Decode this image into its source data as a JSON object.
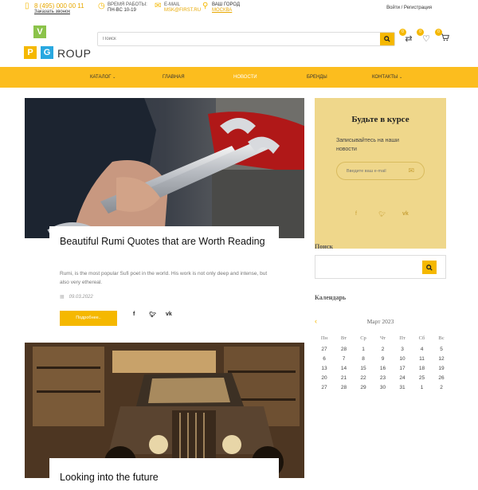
{
  "topbar": {
    "phone": "8 (495) 000 00 11",
    "callback": "Заказать звонок",
    "hours_label": "ВРЕМЯ РАБОТЫ:",
    "hours_value": "ПН-ВС 10-19",
    "email_label": "E-MAIL",
    "email_value": "MSK@FIRST.RU",
    "city_label": "ВАШ ГОРОД",
    "city_value": "МОСКВА",
    "login": "Войти / Регистрация"
  },
  "logo": {
    "v": "V",
    "p": "P",
    "g": "G",
    "rest": "ROUP"
  },
  "search": {
    "placeholder": "Поиск"
  },
  "header_icons": [
    {
      "name": "compare-icon",
      "count": "0"
    },
    {
      "name": "heart-icon",
      "count": "0"
    },
    {
      "name": "cart-icon",
      "count": "0"
    }
  ],
  "nav": {
    "items": [
      "КАТАЛОГ",
      "ГЛАВНАЯ",
      "НОВОСТИ",
      "БРЕНДЫ",
      "КОНТАКТЫ"
    ],
    "active": "НОВОСТИ"
  },
  "posts": [
    {
      "title": "Beautiful Rumi Quotes that are Worth Reading",
      "excerpt": "Rumi, is the most popular Sufi poet in the world. His work is not only deep and intense, but also very ethereal.",
      "date": "09.03.2022",
      "more": "Подробнее.."
    },
    {
      "title": "Looking into the future"
    }
  ],
  "subscribe": {
    "title": "Будьте в курсе",
    "text": "Записывайтесь на наши новости",
    "placeholder": "Введите ваш e-mail"
  },
  "share_icons": [
    "f",
    "t",
    "vk"
  ],
  "sidebar": {
    "search_title": "Поиск",
    "calendar_title": "Календарь"
  },
  "calendar": {
    "prev": "‹",
    "month": "Март 2023",
    "weekdays": [
      "Пн",
      "Вт",
      "Ср",
      "Чт",
      "Пт",
      "Сб",
      "Вс"
    ],
    "weeks": [
      [
        "27",
        "28",
        "1",
        "2",
        "3",
        "4",
        "5"
      ],
      [
        "6",
        "7",
        "8",
        "9",
        "10",
        "11",
        "12"
      ],
      [
        "13",
        "14",
        "15",
        "16",
        "17",
        "18",
        "19"
      ],
      [
        "20",
        "21",
        "22",
        "23",
        "24",
        "25",
        "26"
      ],
      [
        "27",
        "28",
        "29",
        "30",
        "31",
        "1",
        "2"
      ]
    ]
  },
  "colors": {
    "accent": "#f5b800",
    "nav": "#fcbd1e",
    "subscribe_bg": "#efd78b",
    "logo_green": "#8bc34a",
    "logo_blue": "#29a8e0"
  }
}
